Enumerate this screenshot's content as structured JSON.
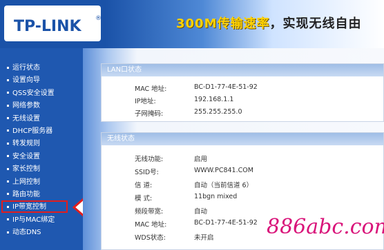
{
  "header": {
    "logo": "TP-LINK",
    "banner": "300M传输速率，实现无线自由",
    "banner_head": "300M传输速率",
    "banner_tail": "，实现无线自由"
  },
  "sidebar": {
    "items": [
      {
        "label": "运行状态"
      },
      {
        "label": "设置向导"
      },
      {
        "label": "QSS安全设置"
      },
      {
        "label": "网络参数"
      },
      {
        "label": "无线设置"
      },
      {
        "label": "DHCP服务器"
      },
      {
        "label": "转发规则"
      },
      {
        "label": "安全设置"
      },
      {
        "label": "家长控制"
      },
      {
        "label": "上网控制"
      },
      {
        "label": "路由功能"
      },
      {
        "label": "IP带宽控制"
      },
      {
        "label": "IP与MAC绑定"
      },
      {
        "label": "动态DNS"
      }
    ]
  },
  "lan_status": {
    "title": "LAN口状态",
    "rows": [
      {
        "label": "MAC 地址:",
        "value": "BC-D1-77-4E-51-92"
      },
      {
        "label": "IP地址:",
        "value": "192.168.1.1"
      },
      {
        "label": "子网掩码:",
        "value": "255.255.255.0"
      }
    ]
  },
  "wireless_status": {
    "title": "无线状态",
    "rows": [
      {
        "label": "无线功能:",
        "value": "启用"
      },
      {
        "label": "SSID号:",
        "value": "WWW.PC841.COM"
      },
      {
        "label": "信 道:",
        "value": "自动（当前信道 6）"
      },
      {
        "label": "模 式:",
        "value": "11bgn mixed"
      },
      {
        "label": "频段带宽:",
        "value": "自动"
      },
      {
        "label": "MAC 地址:",
        "value": "BC-D1-77-4E-51-92"
      },
      {
        "label": "WDS状态:",
        "value": "未开启"
      }
    ]
  },
  "watermark": "886abc.com",
  "colors": {
    "header_blue": "#1a52a8",
    "sidebar_blue": "#1f58b0",
    "highlight_red": "#e21d1d",
    "watermark": "#d9147a"
  }
}
